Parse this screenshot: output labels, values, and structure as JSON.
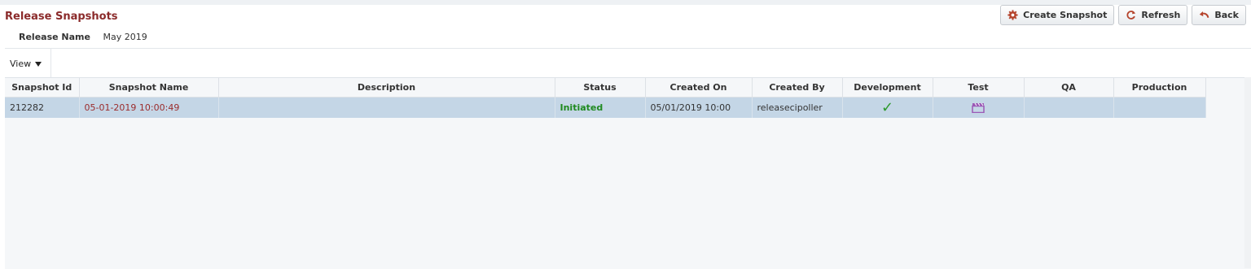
{
  "page": {
    "title": "Release Snapshots",
    "release_label": "Release Name",
    "release_value": "May 2019"
  },
  "toolbar": {
    "create_label": "Create Snapshot",
    "refresh_label": "Refresh",
    "back_label": "Back",
    "view_label": "View"
  },
  "table": {
    "headers": [
      "Snapshot Id",
      "Snapshot Name",
      "Description",
      "Status",
      "Created On",
      "Created By",
      "Development",
      "Test",
      "QA",
      "Production"
    ],
    "rows": [
      {
        "id": "212282",
        "name": "05-01-2019 10:00:49",
        "description": "",
        "status": "Initiated",
        "created_on": "05/01/2019 10:00",
        "created_by": "releasecipoller",
        "development": "check-icon",
        "test": "clapperboard-icon",
        "qa": "",
        "production": ""
      }
    ]
  },
  "colors": {
    "title": "#8b2b2b",
    "status_initiated": "#1f8a1f",
    "row_selected": "#c4d6e6",
    "check": "#2d9a2d",
    "test_icon": "#9b59b6"
  }
}
